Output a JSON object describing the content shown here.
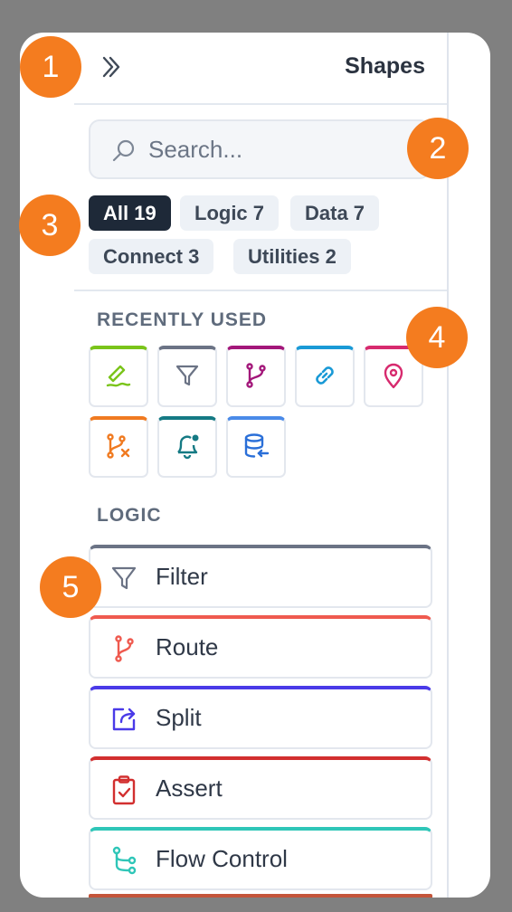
{
  "panel": {
    "title": "Shapes",
    "search": {
      "placeholder": "Search..."
    }
  },
  "filters": [
    {
      "label": "All 19",
      "active": true
    },
    {
      "label": "Logic 7",
      "active": false
    },
    {
      "label": "Data 7",
      "active": false
    },
    {
      "label": "Connect 3",
      "active": false
    },
    {
      "label": "Utilities 2",
      "active": false
    }
  ],
  "recent": {
    "heading": "RECENTLY USED",
    "items": [
      {
        "icon": "signature-icon",
        "color": "#7ac41a"
      },
      {
        "icon": "filter-icon",
        "color": "#6b7385"
      },
      {
        "icon": "git-branch-icon",
        "color": "#a3177a"
      },
      {
        "icon": "link-icon",
        "color": "#1a9ad6"
      },
      {
        "icon": "map-pin-icon",
        "color": "#d72a6e"
      },
      {
        "icon": "git-branch-x-icon",
        "color": "#f07a20"
      },
      {
        "icon": "bell-alert-icon",
        "color": "#157a84"
      },
      {
        "icon": "database-import-icon",
        "color": "#2a6fd8"
      }
    ]
  },
  "logic": {
    "heading": "LOGIC",
    "items": [
      {
        "label": "Filter",
        "icon": "filter-icon",
        "color": "#6b7385"
      },
      {
        "label": "Route",
        "icon": "git-branch-icon",
        "color": "#ef5a4f"
      },
      {
        "label": "Split",
        "icon": "split-share-icon",
        "color": "#4a3ae8"
      },
      {
        "label": "Assert",
        "icon": "clipboard-check-icon",
        "color": "#d22f2f"
      },
      {
        "label": "Flow Control",
        "icon": "flow-control-icon",
        "color": "#2fc6b8"
      }
    ]
  },
  "callouts": [
    "1",
    "2",
    "3",
    "4",
    "5"
  ]
}
